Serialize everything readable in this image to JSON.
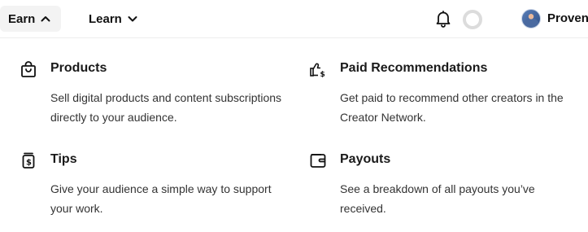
{
  "nav": {
    "earn_label": "Earn",
    "learn_label": "Learn",
    "user_name": "Proven"
  },
  "menu": {
    "items": [
      {
        "title": "Products",
        "description": "Sell digital products and content subscriptions directly to your audience.",
        "icon": "shopping-bag-icon"
      },
      {
        "title": "Paid Recommendations",
        "description": "Get paid to recommend other creators in the Creator Network.",
        "icon": "thumbs-up-dollar-icon"
      },
      {
        "title": "Tips",
        "description": "Give your audience a simple way to support your work.",
        "icon": "tip-jar-icon"
      },
      {
        "title": "Payouts",
        "description": "See a breakdown of all payouts you’ve received.",
        "icon": "wallet-icon"
      }
    ]
  },
  "icons": {
    "earn_toggle": "chevron-up-icon",
    "learn_toggle": "chevron-down-icon",
    "notifications": "bell-icon",
    "loading": "spinner-icon"
  }
}
